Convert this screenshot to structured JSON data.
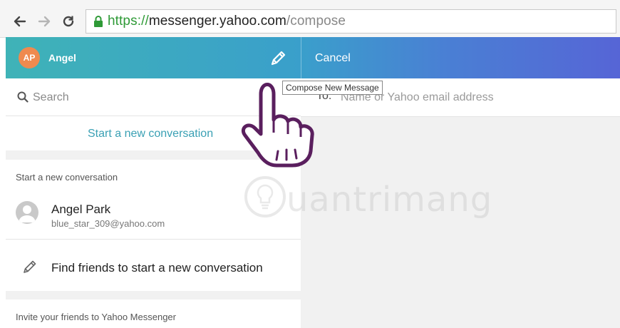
{
  "browser": {
    "url_protocol": "https://",
    "url_host": "messenger.yahoo.com",
    "url_path": "/compose",
    "icons": [
      "back-arrow-icon",
      "forward-arrow-icon",
      "reload-icon",
      "lock-icon"
    ]
  },
  "header": {
    "avatar_initials": "AP",
    "user_name": "Angel",
    "compose_icon": "pencil-icon",
    "cancel_label": "Cancel",
    "colors": {
      "avatar": "#ef8a4f",
      "gradient_start": "#3fb3b7",
      "gradient_end": "#5665d6"
    }
  },
  "tooltip": {
    "text": "Compose New Message"
  },
  "left_panel": {
    "search_placeholder": "Search",
    "start_link": "Start a new conversation",
    "section_title": "Start a new conversation",
    "contact": {
      "name": "Angel Park",
      "email": "blue_star_309@yahoo.com"
    },
    "find_friends_label": "Find friends to start a new conversation",
    "invite_title": "Invite your friends to Yahoo Messenger"
  },
  "compose": {
    "to_label": "To:",
    "to_placeholder": "Name or Yahoo email address"
  },
  "watermark": {
    "text": "uantrimang"
  }
}
